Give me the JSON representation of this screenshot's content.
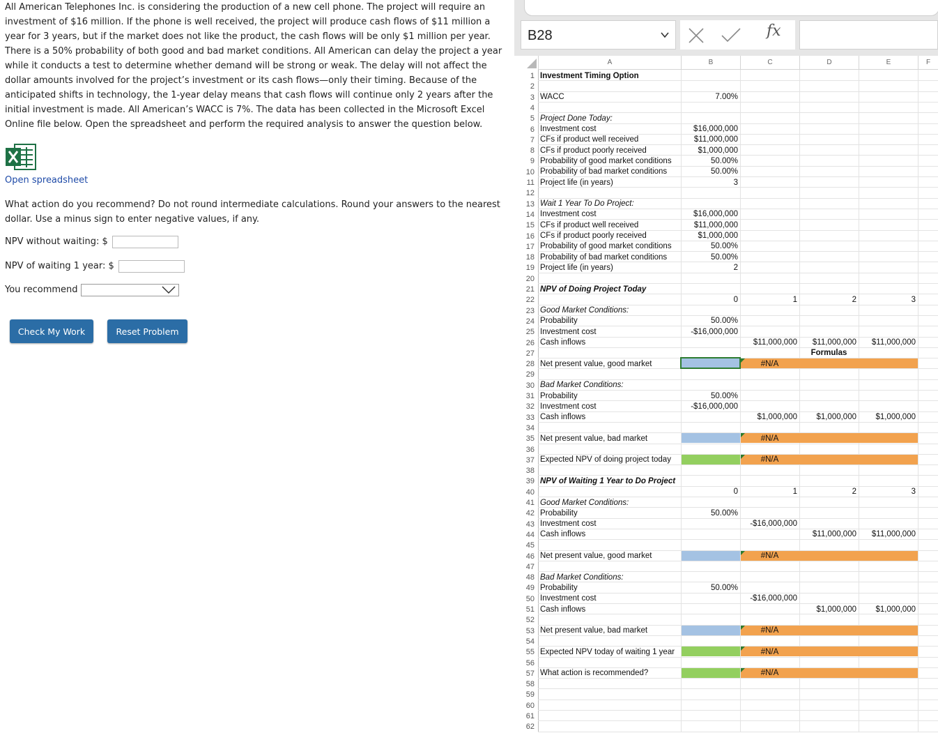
{
  "question": {
    "problem_text": "All American Telephones Inc. is considering the production of a new cell phone. The project will require an investment of $16 million. If the phone is well received, the project will produce cash flows of $11 million a year for 3 years, but if the market does not like the product, the cash flows will be only $1 million per year. There is a 50% probability of both good and bad market conditions. All American can delay the project a year while it conducts a test to determine whether demand will be strong or weak. The delay will not affect the dollar amounts involved for the project’s investment or its cash flows—only their timing. Because of the anticipated shifts in technology, the 1-year delay means that cash flows will continue only 2 years after the initial investment is made. All American’s WACC is 7%. The data has been collected in the Microsoft Excel Online file below. Open the spreadsheet and perform the required analysis to answer the question below.",
    "open_spreadsheet_label": "Open spreadsheet",
    "excel_icon": "excel-icon",
    "prompt_text": "What action do you recommend? Do not round intermediate calculations. Round your answers to the nearest dollar. Use a minus sign to enter negative values, if any.",
    "npv_without_waiting_label": "NPV without waiting: $",
    "npv_without_waiting_value": "",
    "npv_waiting_label": "NPV of waiting 1 year: $",
    "npv_waiting_value": "",
    "recommend_label": "You recommend",
    "recommend_selected": "",
    "check_button": "Check My Work",
    "reset_button": "Reset Problem"
  },
  "spreadsheet": {
    "name_box": "B28",
    "formula": "",
    "fx_label": "fx",
    "colors": {
      "blue": "#a4c2e3",
      "green": "#93cf5f",
      "orange": "#f2a24e",
      "accent": "#2b6da6"
    },
    "columns": [
      "A",
      "B",
      "C",
      "D",
      "E",
      "F"
    ],
    "rows": [
      {
        "n": "1",
        "A": "Investment Timing Option"
      },
      {
        "n": "2"
      },
      {
        "n": "3",
        "A": "WACC",
        "B": "7.00%"
      },
      {
        "n": "4"
      },
      {
        "n": "5",
        "A": "Project Done Today:"
      },
      {
        "n": "6",
        "A": "Investment cost",
        "B": "$16,000,000"
      },
      {
        "n": "7",
        "A": "CFs if product well received",
        "B": "$11,000,000"
      },
      {
        "n": "8",
        "A": "CFs if product poorly received",
        "B": "$1,000,000"
      },
      {
        "n": "9",
        "A": "Probability of good market conditions",
        "B": "50.00%"
      },
      {
        "n": "10",
        "A": "Probability of bad market conditions",
        "B": "50.00%"
      },
      {
        "n": "11",
        "A": "Project life (in years)",
        "B": "3"
      },
      {
        "n": "12"
      },
      {
        "n": "13",
        "A": "Wait 1 Year To Do Project:"
      },
      {
        "n": "14",
        "A": "Investment cost",
        "B": "$16,000,000"
      },
      {
        "n": "15",
        "A": "CFs if product well received",
        "B": "$11,000,000"
      },
      {
        "n": "16",
        "A": "CFs if product poorly received",
        "B": "$1,000,000"
      },
      {
        "n": "17",
        "A": "Probability of good market conditions",
        "B": "50.00%"
      },
      {
        "n": "18",
        "A": "Probability of bad market conditions",
        "B": "50.00%"
      },
      {
        "n": "19",
        "A": "Project life (in years)",
        "B": "2"
      },
      {
        "n": "20"
      },
      {
        "n": "21",
        "A": "NPV of Doing Project Today"
      },
      {
        "n": "22",
        "B": "0",
        "C": "1",
        "D": "2",
        "E": "3"
      },
      {
        "n": "23",
        "A": "Good Market Conditions:"
      },
      {
        "n": "24",
        "A": "Probability",
        "B": "50.00%"
      },
      {
        "n": "25",
        "A": "Investment cost",
        "B": "-$16,000,000"
      },
      {
        "n": "26",
        "A": "Cash inflows",
        "C": "$11,000,000",
        "D": "$11,000,000",
        "E": "$11,000,000"
      },
      {
        "n": "27",
        "D": "Formulas"
      },
      {
        "n": "28",
        "A": "Net present value, good market",
        "C": "#N/A"
      },
      {
        "n": "29"
      },
      {
        "n": "30",
        "A": "Bad Market Conditions:"
      },
      {
        "n": "31",
        "A": "Probability",
        "B": "50.00%"
      },
      {
        "n": "32",
        "A": "Investment cost",
        "B": "-$16,000,000"
      },
      {
        "n": "33",
        "A": "Cash inflows",
        "C": "$1,000,000",
        "D": "$1,000,000",
        "E": "$1,000,000"
      },
      {
        "n": "34"
      },
      {
        "n": "35",
        "A": "Net present value, bad market",
        "C": "#N/A"
      },
      {
        "n": "36"
      },
      {
        "n": "37",
        "A": "Expected NPV of doing project today",
        "C": "#N/A"
      },
      {
        "n": "38"
      },
      {
        "n": "39",
        "A": "NPV of Waiting 1 Year to Do Project"
      },
      {
        "n": "40",
        "B": "0",
        "C": "1",
        "D": "2",
        "E": "3"
      },
      {
        "n": "41",
        "A": "Good Market Conditions:"
      },
      {
        "n": "42",
        "A": "Probability",
        "B": "50.00%"
      },
      {
        "n": "43",
        "A": "Investment cost",
        "C": "-$16,000,000"
      },
      {
        "n": "44",
        "A": "Cash inflows",
        "D": "$11,000,000",
        "E": "$11,000,000"
      },
      {
        "n": "45"
      },
      {
        "n": "46",
        "A": "Net present value, good market",
        "C": "#N/A"
      },
      {
        "n": "47"
      },
      {
        "n": "48",
        "A": "Bad Market Conditions:"
      },
      {
        "n": "49",
        "A": "Probability",
        "B": "50.00%"
      },
      {
        "n": "50",
        "A": "Investment cost",
        "C": "-$16,000,000"
      },
      {
        "n": "51",
        "A": "Cash inflows",
        "D": "$1,000,000",
        "E": "$1,000,000"
      },
      {
        "n": "52"
      },
      {
        "n": "53",
        "A": "Net present value, bad market",
        "C": "#N/A"
      },
      {
        "n": "54"
      },
      {
        "n": "55",
        "A": "Expected NPV today of waiting 1 year",
        "C": "#N/A"
      },
      {
        "n": "56"
      },
      {
        "n": "57",
        "A": "What action is recommended?",
        "C": "#N/A"
      },
      {
        "n": "58"
      },
      {
        "n": "59"
      },
      {
        "n": "60"
      },
      {
        "n": "61"
      },
      {
        "n": "62"
      }
    ]
  }
}
